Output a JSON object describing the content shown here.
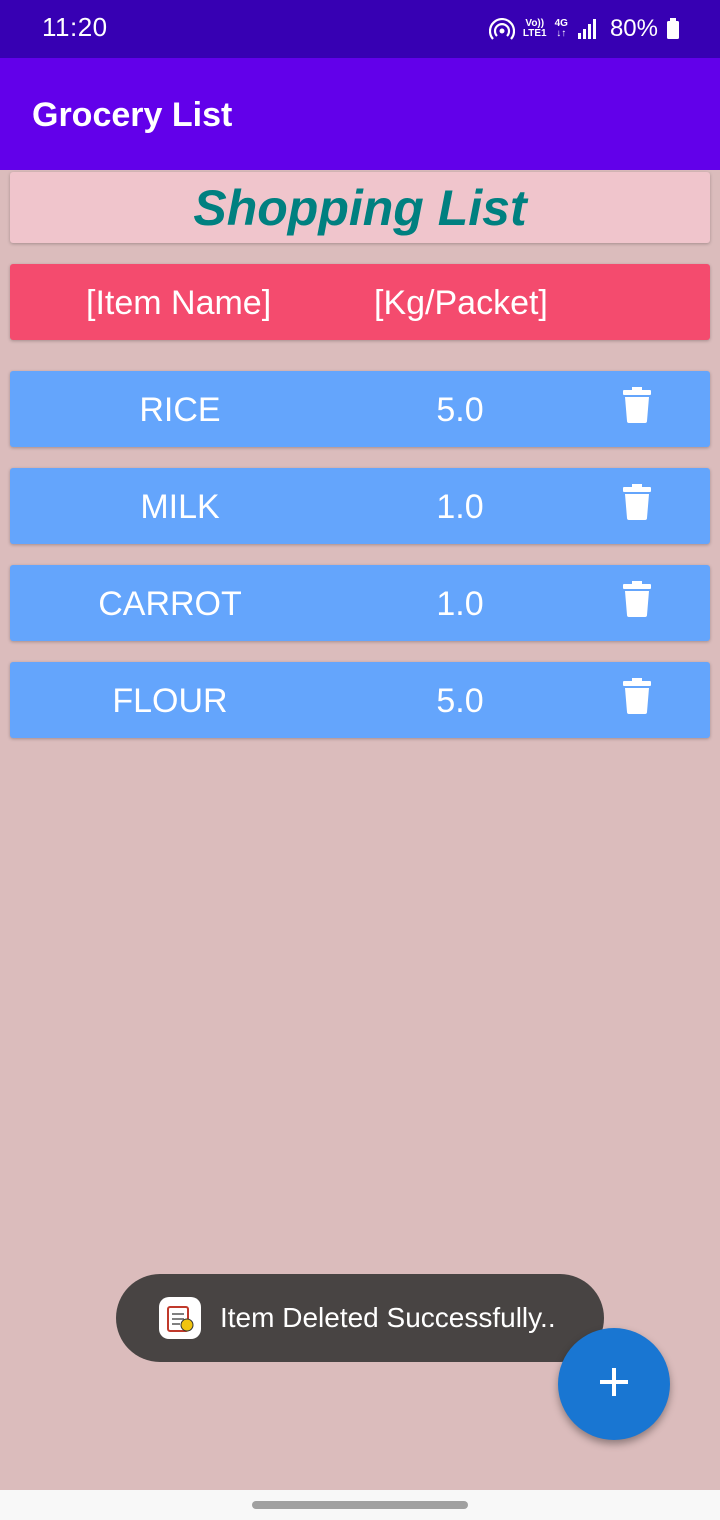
{
  "status_bar": {
    "time": "11:20",
    "volte_line1": "Vo))",
    "volte_line2": "LTE1",
    "network": "4G",
    "battery": "80%"
  },
  "app_bar": {
    "title": "Grocery List"
  },
  "heading": {
    "title": "Shopping List"
  },
  "columns": {
    "name": "[Item Name]",
    "unit": "[Kg/Packet]"
  },
  "items": [
    {
      "name": "RICE",
      "qty": "5.0"
    },
    {
      "name": "MILK",
      "qty": "1.0"
    },
    {
      "name": "CARROT",
      "qty": "1.0"
    },
    {
      "name": "FLOUR",
      "qty": "5.0"
    }
  ],
  "toast": {
    "message": "Item Deleted Successfully.."
  },
  "icons": {
    "delete": "trash-icon",
    "fab": "plus-icon",
    "toast": "app-icon"
  },
  "colors": {
    "status_bar": "#3700b3",
    "app_bar": "#6200ea",
    "background": "#dbbcbc",
    "heading_card": "#f0c5cc",
    "heading_text": "#008080",
    "column_header": "#f44b6e",
    "item_row": "#64a5fc",
    "fab": "#1976d2",
    "toast": "#484443"
  }
}
